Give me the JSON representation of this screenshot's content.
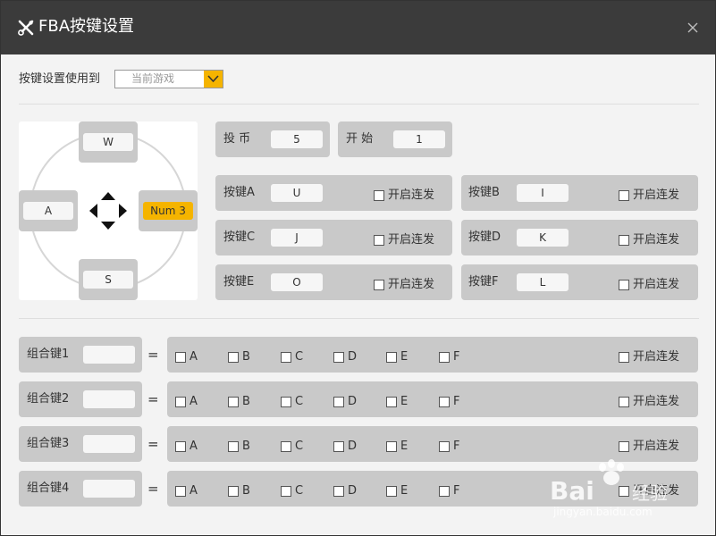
{
  "window": {
    "title": "FBA按键设置",
    "close_icon": "close-icon"
  },
  "target": {
    "label": "按键设置使用到",
    "value": "当前游戏"
  },
  "dpad": {
    "up": "W",
    "left": "A",
    "right": "Num 3",
    "down": "S"
  },
  "coin": {
    "label": "投 币",
    "value": "5"
  },
  "start": {
    "label": "开 始",
    "value": "1"
  },
  "rapid_fire_label": "开启连发",
  "buttons": [
    {
      "label": "按键A",
      "value": "U",
      "rapid": "开启连发"
    },
    {
      "label": "按键B",
      "value": "I",
      "rapid": "开启连发"
    },
    {
      "label": "按键C",
      "value": "J",
      "rapid": "开启连发"
    },
    {
      "label": "按键D",
      "value": "K",
      "rapid": "开启连发"
    },
    {
      "label": "按键E",
      "value": "O",
      "rapid": "开启连发"
    },
    {
      "label": "按键F",
      "value": "L",
      "rapid": "开启连发"
    }
  ],
  "combos": [
    {
      "label": "组合键1",
      "value": "",
      "eq": "=",
      "options": [
        "A",
        "B",
        "C",
        "D",
        "E",
        "F"
      ],
      "rapid": "开启连发"
    },
    {
      "label": "组合键2",
      "value": "",
      "eq": "=",
      "options": [
        "A",
        "B",
        "C",
        "D",
        "E",
        "F"
      ],
      "rapid": "开启连发"
    },
    {
      "label": "组合键3",
      "value": "",
      "eq": "=",
      "options": [
        "A",
        "B",
        "C",
        "D",
        "E",
        "F"
      ],
      "rapid": "开启连发"
    },
    {
      "label": "组合键4",
      "value": "",
      "eq": "=",
      "options": [
        "A",
        "B",
        "C",
        "D",
        "E",
        "F"
      ],
      "rapid": "开启连发"
    }
  ],
  "colors": {
    "titlebar": "#3b3b3b",
    "accent": "#f5b400",
    "panel": "#c9c9c9",
    "background": "#f3f3f3"
  }
}
